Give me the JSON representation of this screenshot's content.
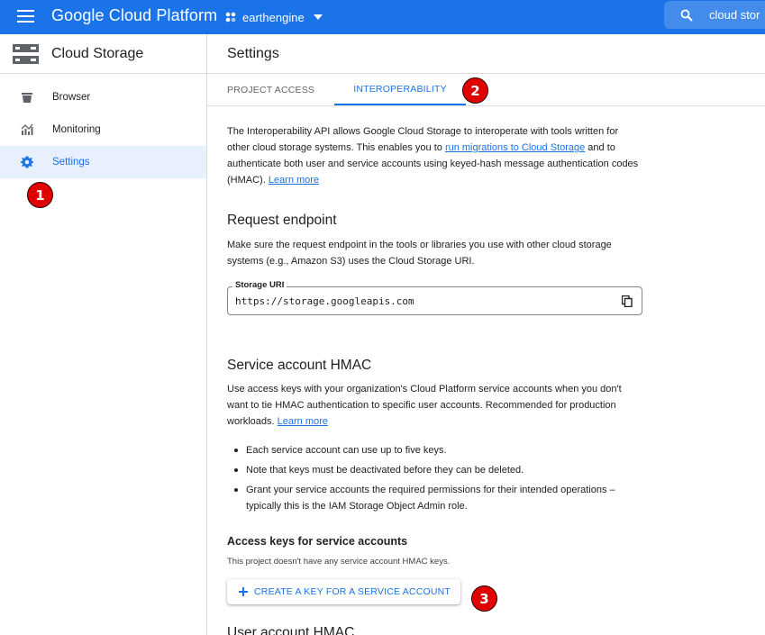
{
  "topbar": {
    "brand": "Google Cloud Platform",
    "project": "earthengine",
    "search_text": "cloud stor"
  },
  "sidebar": {
    "title": "Cloud Storage",
    "items": [
      {
        "label": "Browser",
        "icon": "bucket-icon",
        "active": false
      },
      {
        "label": "Monitoring",
        "icon": "monitoring-icon",
        "active": false
      },
      {
        "label": "Settings",
        "icon": "gear-icon",
        "active": true
      }
    ]
  },
  "markers": {
    "m1": "1",
    "m2": "2",
    "m3": "3"
  },
  "page": {
    "title": "Settings",
    "tabs": [
      {
        "label": "PROJECT ACCESS",
        "active": false
      },
      {
        "label": "INTEROPERABILITY",
        "active": true
      }
    ]
  },
  "intro": {
    "text1": "The Interoperability API allows Google Cloud Storage to interoperate with tools written for other cloud storage systems. This enables you to ",
    "link1": "run migrations to Cloud Storage",
    "text2": " and to authenticate both user and service accounts using keyed-hash message authentication codes (HMAC). ",
    "link2": "Learn more"
  },
  "request_endpoint": {
    "heading": "Request endpoint",
    "description": "Make sure the request endpoint in the tools or libraries you use with other cloud storage systems (e.g., Amazon S3) uses the Cloud Storage URI.",
    "uri_label": "Storage URI",
    "uri_value": "https://storage.googleapis.com"
  },
  "service_hmac": {
    "heading": "Service account HMAC",
    "text": "Use access keys with your organization's Cloud Platform service accounts when you don't want to tie HMAC authentication to specific user accounts. Recommended for production workloads. ",
    "link": "Learn more",
    "bullets": [
      "Each service account can use up to five keys.",
      "Note that keys must be deactivated before they can be deleted.",
      "Grant your service accounts the required permissions for their intended operations – typically this is the IAM Storage Object Admin role."
    ],
    "subheading": "Access keys for service accounts",
    "empty_text": "This project doesn't have any service account HMAC keys.",
    "create_button": "CREATE A KEY FOR A SERVICE ACCOUNT"
  },
  "user_hmac": {
    "heading": "User account HMAC"
  },
  "colors": {
    "brand_blue": "#1a73e8",
    "marker_red": "#e10000",
    "active_bg": "#e8f0fe"
  }
}
